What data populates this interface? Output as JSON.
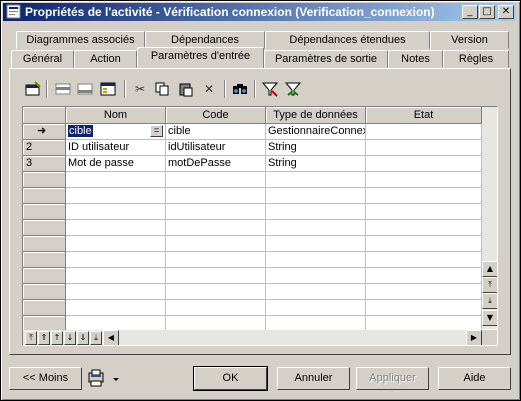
{
  "window": {
    "title": "Propriétés de l'activité - Vérification connexion (Verification_connexion)",
    "controls": {
      "minimize": "_",
      "maximize": "□",
      "close": "✕"
    }
  },
  "tabs": {
    "row1": [
      "Diagrammes associés",
      "Dépendances",
      "Dépendances étendues",
      "Version"
    ],
    "row2": [
      "Général",
      "Action",
      "Paramètres d'entrée",
      "Paramètres de sortie",
      "Notes",
      "Règles"
    ],
    "active": "Paramètres d'entrée"
  },
  "toolbar": {
    "icons": [
      "properties-icon",
      "insert-row-icon",
      "add-row-icon",
      "add-objects-icon",
      "cut-icon",
      "copy-icon",
      "paste-icon",
      "delete-icon",
      "find-icon",
      "filter-icon",
      "clear-filter-icon"
    ]
  },
  "table": {
    "columns": [
      "Nom",
      "Code",
      "Type de données",
      "Etat"
    ],
    "rows": [
      {
        "marker": "➜",
        "nom": "cible",
        "code": "cible",
        "type": "GestionnaireConnex",
        "etat": ""
      },
      {
        "marker": "2",
        "nom": "ID utilisateur",
        "code": "idUtilisateur",
        "type": "String",
        "etat": ""
      },
      {
        "marker": "3",
        "nom": "Mot de passe",
        "code": "motDePasse",
        "type": "String",
        "etat": ""
      }
    ],
    "empty_rows": 10
  },
  "buttons": {
    "less": "<< Moins",
    "ok": "OK",
    "cancel": "Annuler",
    "apply": "Appliquer",
    "help": "Aide"
  }
}
